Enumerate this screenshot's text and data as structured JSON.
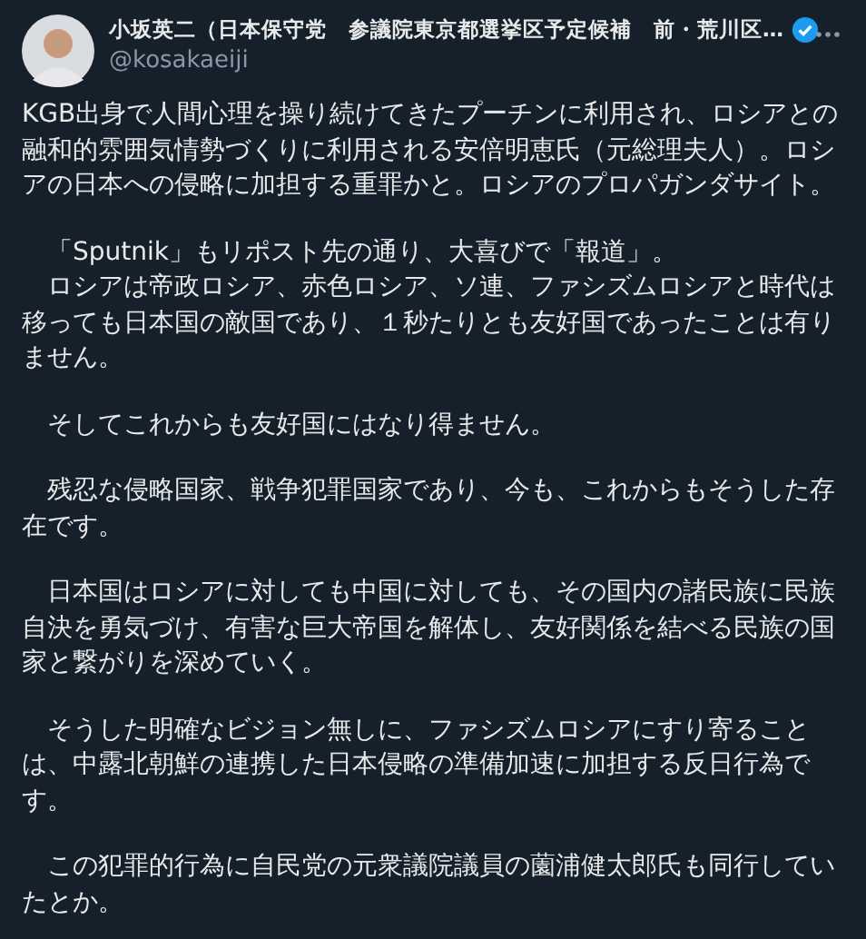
{
  "author": {
    "name": "小坂英二（日本保守党　参議院東京都選挙区予定候補　前・荒川区…",
    "handle": "@kosakaeiji",
    "verified": true
  },
  "paragraphs": [
    "KGB出身で人間心理を操り続けてきたプーチンに利用され、ロシアとの融和的雰囲気情勢づくりに利用される安倍明恵氏（元総理夫人）。ロシアの日本への侵略に加担する重罪かと。ロシアのプロパガンダサイト。",
    "　「Sputnik」もリポスト先の通り、大喜びで「報道」。",
    "　ロシアは帝政ロシア、赤色ロシア、ソ連、ファシズムロシアと時代は移っても日本国の敵国であり、１秒たりとも友好国であったことは有りません。",
    "　そしてこれからも友好国にはなり得ません。",
    "　残忍な侵略国家、戦争犯罪国家であり、今も、これからもそうした存在です。",
    "　日本国はロシアに対しても中国に対しても、その国内の諸民族に民族自決を勇気づけ、有害な巨大帝国を解体し、友好関係を結べる民族の国家と繋がりを深めていく。",
    "　そうした明確なビジョン無しに、ファシズムロシアにすり寄ることは、中露北朝鮮の連携した日本侵略の準備加速に加担する反日行為です。",
    "　この犯罪的行為に自民党の元衆議院議員の薗浦健太郎氏も同行していたとか。"
  ]
}
